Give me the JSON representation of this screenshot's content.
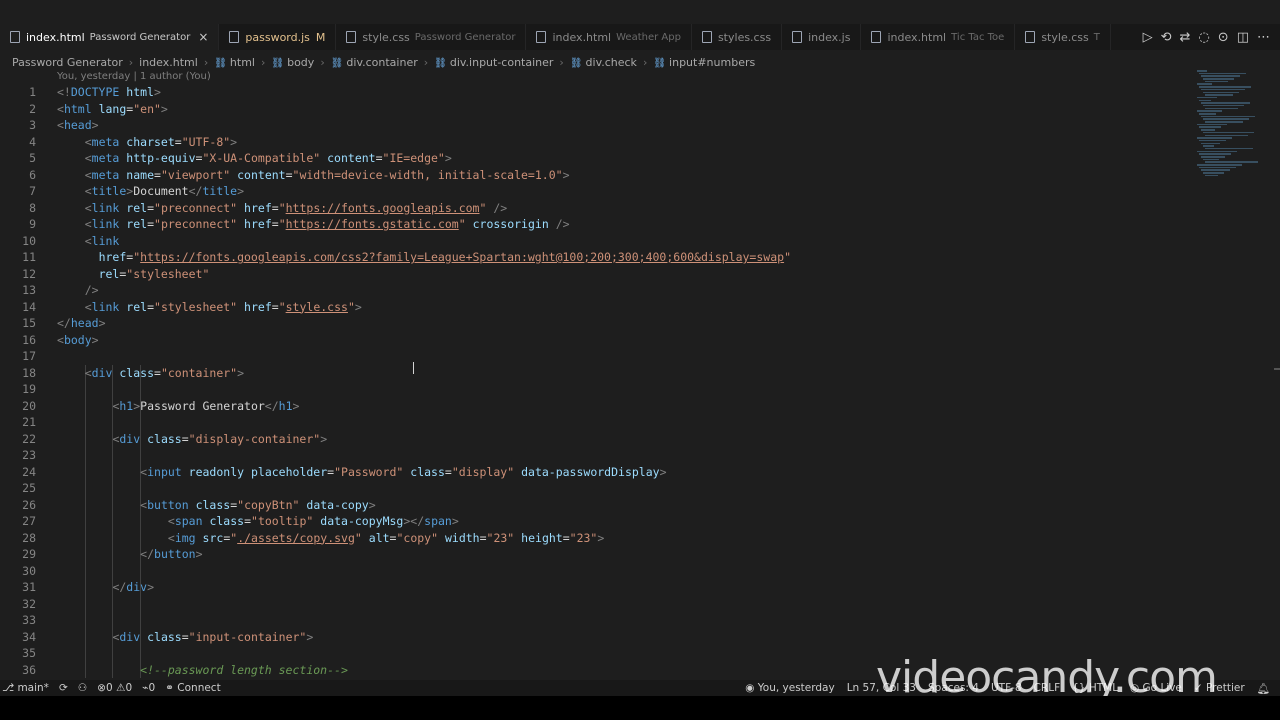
{
  "tabs": [
    {
      "label": "index.html",
      "desc": "Password Generator",
      "active": true,
      "modified": false,
      "close": "×"
    },
    {
      "label": "password.js",
      "desc": "",
      "active": false,
      "modified": true,
      "mod": "M"
    },
    {
      "label": "style.css",
      "desc": "Password Generator",
      "active": false
    },
    {
      "label": "index.html",
      "desc": "Weather App",
      "active": false
    },
    {
      "label": "styles.css",
      "desc": "",
      "active": false
    },
    {
      "label": "index.js",
      "desc": "",
      "active": false
    },
    {
      "label": "index.html",
      "desc": "Tic Tac Toe",
      "active": false
    },
    {
      "label": "style.css",
      "desc": "T",
      "active": false
    }
  ],
  "tab_actions": [
    "run-icon",
    "source-control-icon",
    "compare-icon",
    "broadcast-icon",
    "copilot-icon",
    "split-editor-icon",
    "more-icon"
  ],
  "breadcrumb": [
    "Password Generator",
    "index.html",
    "html",
    "body",
    "div.container",
    "div.input-container",
    "div.check",
    "input#numbers"
  ],
  "blame": "You, yesterday | 1 author (You)",
  "code_lines": [
    {
      "n": "1",
      "indent": 0,
      "tokens": [
        [
          "t-br",
          "<!"
        ],
        [
          "t-tag",
          "DOCTYPE"
        ],
        [
          "t-txt",
          " "
        ],
        [
          "t-attr",
          "html"
        ],
        [
          "t-br",
          ">"
        ]
      ]
    },
    {
      "n": "2",
      "indent": 0,
      "tokens": [
        [
          "t-br",
          "<"
        ],
        [
          "t-tag",
          "html"
        ],
        [
          "t-txt",
          " "
        ],
        [
          "t-attr",
          "lang"
        ],
        [
          "t-txt",
          "="
        ],
        [
          "t-str",
          "\"en\""
        ],
        [
          "t-br",
          ">"
        ]
      ]
    },
    {
      "n": "3",
      "indent": 0,
      "tokens": [
        [
          "t-br",
          "<"
        ],
        [
          "t-tag",
          "head"
        ],
        [
          "t-br",
          ">"
        ]
      ]
    },
    {
      "n": "4",
      "indent": 4,
      "tokens": [
        [
          "t-br",
          "<"
        ],
        [
          "t-tag",
          "meta"
        ],
        [
          "t-txt",
          " "
        ],
        [
          "t-attr",
          "charset"
        ],
        [
          "t-txt",
          "="
        ],
        [
          "t-str",
          "\"UTF-8\""
        ],
        [
          "t-br",
          ">"
        ]
      ]
    },
    {
      "n": "5",
      "indent": 4,
      "tokens": [
        [
          "t-br",
          "<"
        ],
        [
          "t-tag",
          "meta"
        ],
        [
          "t-txt",
          " "
        ],
        [
          "t-attr",
          "http-equiv"
        ],
        [
          "t-txt",
          "="
        ],
        [
          "t-str",
          "\"X-UA-Compatible\""
        ],
        [
          "t-txt",
          " "
        ],
        [
          "t-attr",
          "content"
        ],
        [
          "t-txt",
          "="
        ],
        [
          "t-str",
          "\"IE=edge\""
        ],
        [
          "t-br",
          ">"
        ]
      ]
    },
    {
      "n": "6",
      "indent": 4,
      "tokens": [
        [
          "t-br",
          "<"
        ],
        [
          "t-tag",
          "meta"
        ],
        [
          "t-txt",
          " "
        ],
        [
          "t-attr",
          "name"
        ],
        [
          "t-txt",
          "="
        ],
        [
          "t-str",
          "\"viewport\""
        ],
        [
          "t-txt",
          " "
        ],
        [
          "t-attr",
          "content"
        ],
        [
          "t-txt",
          "="
        ],
        [
          "t-str",
          "\"width=device-width, initial-scale=1.0\""
        ],
        [
          "t-br",
          ">"
        ]
      ]
    },
    {
      "n": "7",
      "indent": 4,
      "tokens": [
        [
          "t-br",
          "<"
        ],
        [
          "t-tag",
          "title"
        ],
        [
          "t-br",
          ">"
        ],
        [
          "t-txt",
          "Document"
        ],
        [
          "t-br",
          "</"
        ],
        [
          "t-tag",
          "title"
        ],
        [
          "t-br",
          ">"
        ]
      ]
    },
    {
      "n": "8",
      "indent": 4,
      "tokens": [
        [
          "t-br",
          "<"
        ],
        [
          "t-tag",
          "link"
        ],
        [
          "t-txt",
          " "
        ],
        [
          "t-attr",
          "rel"
        ],
        [
          "t-txt",
          "="
        ],
        [
          "t-str",
          "\"preconnect\""
        ],
        [
          "t-txt",
          " "
        ],
        [
          "t-attr",
          "href"
        ],
        [
          "t-txt",
          "="
        ],
        [
          "t-str",
          "\""
        ],
        [
          "t-link",
          "https://fonts.googleapis.com"
        ],
        [
          "t-str",
          "\""
        ],
        [
          "t-txt",
          " "
        ],
        [
          "t-br",
          "/>"
        ]
      ]
    },
    {
      "n": "9",
      "indent": 4,
      "tokens": [
        [
          "t-br",
          "<"
        ],
        [
          "t-tag",
          "link"
        ],
        [
          "t-txt",
          " "
        ],
        [
          "t-attr",
          "rel"
        ],
        [
          "t-txt",
          "="
        ],
        [
          "t-str",
          "\"preconnect\""
        ],
        [
          "t-txt",
          " "
        ],
        [
          "t-attr",
          "href"
        ],
        [
          "t-txt",
          "="
        ],
        [
          "t-str",
          "\""
        ],
        [
          "t-link",
          "https://fonts.gstatic.com"
        ],
        [
          "t-str",
          "\""
        ],
        [
          "t-txt",
          " "
        ],
        [
          "t-attr",
          "crossorigin"
        ],
        [
          "t-txt",
          " "
        ],
        [
          "t-br",
          "/>"
        ]
      ]
    },
    {
      "n": "10",
      "indent": 4,
      "tokens": [
        [
          "t-br",
          "<"
        ],
        [
          "t-tag",
          "link"
        ]
      ]
    },
    {
      "n": "11",
      "indent": 6,
      "tokens": [
        [
          "t-attr",
          "href"
        ],
        [
          "t-txt",
          "="
        ],
        [
          "t-str",
          "\""
        ],
        [
          "t-link",
          "https://fonts.googleapis.com/css2?family=League+Spartan:wght@100;200;300;400;600&display=swap"
        ],
        [
          "t-str",
          "\""
        ]
      ]
    },
    {
      "n": "12",
      "indent": 6,
      "tokens": [
        [
          "t-attr",
          "rel"
        ],
        [
          "t-txt",
          "="
        ],
        [
          "t-str",
          "\"stylesheet\""
        ]
      ]
    },
    {
      "n": "13",
      "indent": 4,
      "tokens": [
        [
          "t-br",
          "/>"
        ]
      ]
    },
    {
      "n": "14",
      "indent": 4,
      "tokens": [
        [
          "t-br",
          "<"
        ],
        [
          "t-tag",
          "link"
        ],
        [
          "t-txt",
          " "
        ],
        [
          "t-attr",
          "rel"
        ],
        [
          "t-txt",
          "="
        ],
        [
          "t-str",
          "\"stylesheet\""
        ],
        [
          "t-txt",
          " "
        ],
        [
          "t-attr",
          "href"
        ],
        [
          "t-txt",
          "="
        ],
        [
          "t-str",
          "\""
        ],
        [
          "t-link",
          "style.css"
        ],
        [
          "t-str",
          "\""
        ],
        [
          "t-br",
          ">"
        ]
      ]
    },
    {
      "n": "15",
      "indent": 0,
      "tokens": [
        [
          "t-br",
          "</"
        ],
        [
          "t-tag",
          "head"
        ],
        [
          "t-br",
          ">"
        ]
      ]
    },
    {
      "n": "16",
      "indent": 0,
      "tokens": [
        [
          "t-br",
          "<"
        ],
        [
          "t-tag",
          "body"
        ],
        [
          "t-br",
          ">"
        ]
      ]
    },
    {
      "n": "17",
      "indent": 0,
      "tokens": []
    },
    {
      "n": "18",
      "indent": 4,
      "tokens": [
        [
          "t-br",
          "<"
        ],
        [
          "t-tag",
          "div"
        ],
        [
          "t-txt",
          " "
        ],
        [
          "t-attr",
          "class"
        ],
        [
          "t-txt",
          "="
        ],
        [
          "t-str",
          "\"container\""
        ],
        [
          "t-br",
          ">"
        ]
      ]
    },
    {
      "n": "19",
      "indent": 0,
      "tokens": []
    },
    {
      "n": "20",
      "indent": 8,
      "tokens": [
        [
          "t-br",
          "<"
        ],
        [
          "t-tag",
          "h1"
        ],
        [
          "t-br",
          ">"
        ],
        [
          "t-txt",
          "Password Generator"
        ],
        [
          "t-br",
          "</"
        ],
        [
          "t-tag",
          "h1"
        ],
        [
          "t-br",
          ">"
        ]
      ]
    },
    {
      "n": "21",
      "indent": 0,
      "tokens": []
    },
    {
      "n": "22",
      "indent": 8,
      "tokens": [
        [
          "t-br",
          "<"
        ],
        [
          "t-tag",
          "div"
        ],
        [
          "t-txt",
          " "
        ],
        [
          "t-attr",
          "class"
        ],
        [
          "t-txt",
          "="
        ],
        [
          "t-str",
          "\"display-container\""
        ],
        [
          "t-br",
          ">"
        ]
      ]
    },
    {
      "n": "23",
      "indent": 0,
      "tokens": []
    },
    {
      "n": "24",
      "indent": 12,
      "tokens": [
        [
          "t-br",
          "<"
        ],
        [
          "t-tag",
          "input"
        ],
        [
          "t-txt",
          " "
        ],
        [
          "t-attr",
          "readonly"
        ],
        [
          "t-txt",
          " "
        ],
        [
          "t-attr",
          "placeholder"
        ],
        [
          "t-txt",
          "="
        ],
        [
          "t-str",
          "\"Password\""
        ],
        [
          "t-txt",
          " "
        ],
        [
          "t-attr",
          "class"
        ],
        [
          "t-txt",
          "="
        ],
        [
          "t-str",
          "\"display\""
        ],
        [
          "t-txt",
          " "
        ],
        [
          "t-attr",
          "data-passwordDisplay"
        ],
        [
          "t-br",
          ">"
        ]
      ]
    },
    {
      "n": "25",
      "indent": 0,
      "tokens": []
    },
    {
      "n": "26",
      "indent": 12,
      "tokens": [
        [
          "t-br",
          "<"
        ],
        [
          "t-tag",
          "button"
        ],
        [
          "t-txt",
          " "
        ],
        [
          "t-attr",
          "class"
        ],
        [
          "t-txt",
          "="
        ],
        [
          "t-str",
          "\"copyBtn\""
        ],
        [
          "t-txt",
          " "
        ],
        [
          "t-attr",
          "data-copy"
        ],
        [
          "t-br",
          ">"
        ]
      ]
    },
    {
      "n": "27",
      "indent": 16,
      "tokens": [
        [
          "t-br",
          "<"
        ],
        [
          "t-tag",
          "span"
        ],
        [
          "t-txt",
          " "
        ],
        [
          "t-attr",
          "class"
        ],
        [
          "t-txt",
          "="
        ],
        [
          "t-str",
          "\"tooltip\""
        ],
        [
          "t-txt",
          " "
        ],
        [
          "t-attr",
          "data-copyMsg"
        ],
        [
          "t-br",
          "></"
        ],
        [
          "t-tag",
          "span"
        ],
        [
          "t-br",
          ">"
        ]
      ]
    },
    {
      "n": "28",
      "indent": 16,
      "tokens": [
        [
          "t-br",
          "<"
        ],
        [
          "t-tag",
          "img"
        ],
        [
          "t-txt",
          " "
        ],
        [
          "t-attr",
          "src"
        ],
        [
          "t-txt",
          "="
        ],
        [
          "t-str",
          "\""
        ],
        [
          "t-link",
          "./assets/copy.svg"
        ],
        [
          "t-str",
          "\""
        ],
        [
          "t-txt",
          " "
        ],
        [
          "t-attr",
          "alt"
        ],
        [
          "t-txt",
          "="
        ],
        [
          "t-str",
          "\"copy\""
        ],
        [
          "t-txt",
          " "
        ],
        [
          "t-attr",
          "width"
        ],
        [
          "t-txt",
          "="
        ],
        [
          "t-str",
          "\"23\""
        ],
        [
          "t-txt",
          " "
        ],
        [
          "t-attr",
          "height"
        ],
        [
          "t-txt",
          "="
        ],
        [
          "t-str",
          "\"23\""
        ],
        [
          "t-br",
          ">"
        ]
      ]
    },
    {
      "n": "29",
      "indent": 12,
      "tokens": [
        [
          "t-br",
          "</"
        ],
        [
          "t-tag",
          "button"
        ],
        [
          "t-br",
          ">"
        ]
      ]
    },
    {
      "n": "30",
      "indent": 0,
      "tokens": []
    },
    {
      "n": "31",
      "indent": 8,
      "tokens": [
        [
          "t-br",
          "</"
        ],
        [
          "t-tag",
          "div"
        ],
        [
          "t-br",
          ">"
        ]
      ]
    },
    {
      "n": "32",
      "indent": 0,
      "tokens": []
    },
    {
      "n": "33",
      "indent": 0,
      "tokens": []
    },
    {
      "n": "34",
      "indent": 8,
      "tokens": [
        [
          "t-br",
          "<"
        ],
        [
          "t-tag",
          "div"
        ],
        [
          "t-txt",
          " "
        ],
        [
          "t-attr",
          "class"
        ],
        [
          "t-txt",
          "="
        ],
        [
          "t-str",
          "\"input-container\""
        ],
        [
          "t-br",
          ">"
        ]
      ]
    },
    {
      "n": "35",
      "indent": 0,
      "tokens": []
    },
    {
      "n": "36",
      "indent": 12,
      "tokens": [
        [
          "t-com",
          "<!--password length section-->"
        ]
      ]
    }
  ],
  "status": {
    "branch": "main*",
    "errors": "0",
    "warnings": "0",
    "ports": "0",
    "connect": "Connect",
    "blame": "You, yesterday",
    "position": "Ln 57, Col 33",
    "spaces": "Spaces: 4",
    "encoding": "UTF-8",
    "eol": "CRLF",
    "language": "HTML",
    "golive": "Go Live",
    "prettier": "Prettier"
  },
  "watermark": "videocandy.com"
}
